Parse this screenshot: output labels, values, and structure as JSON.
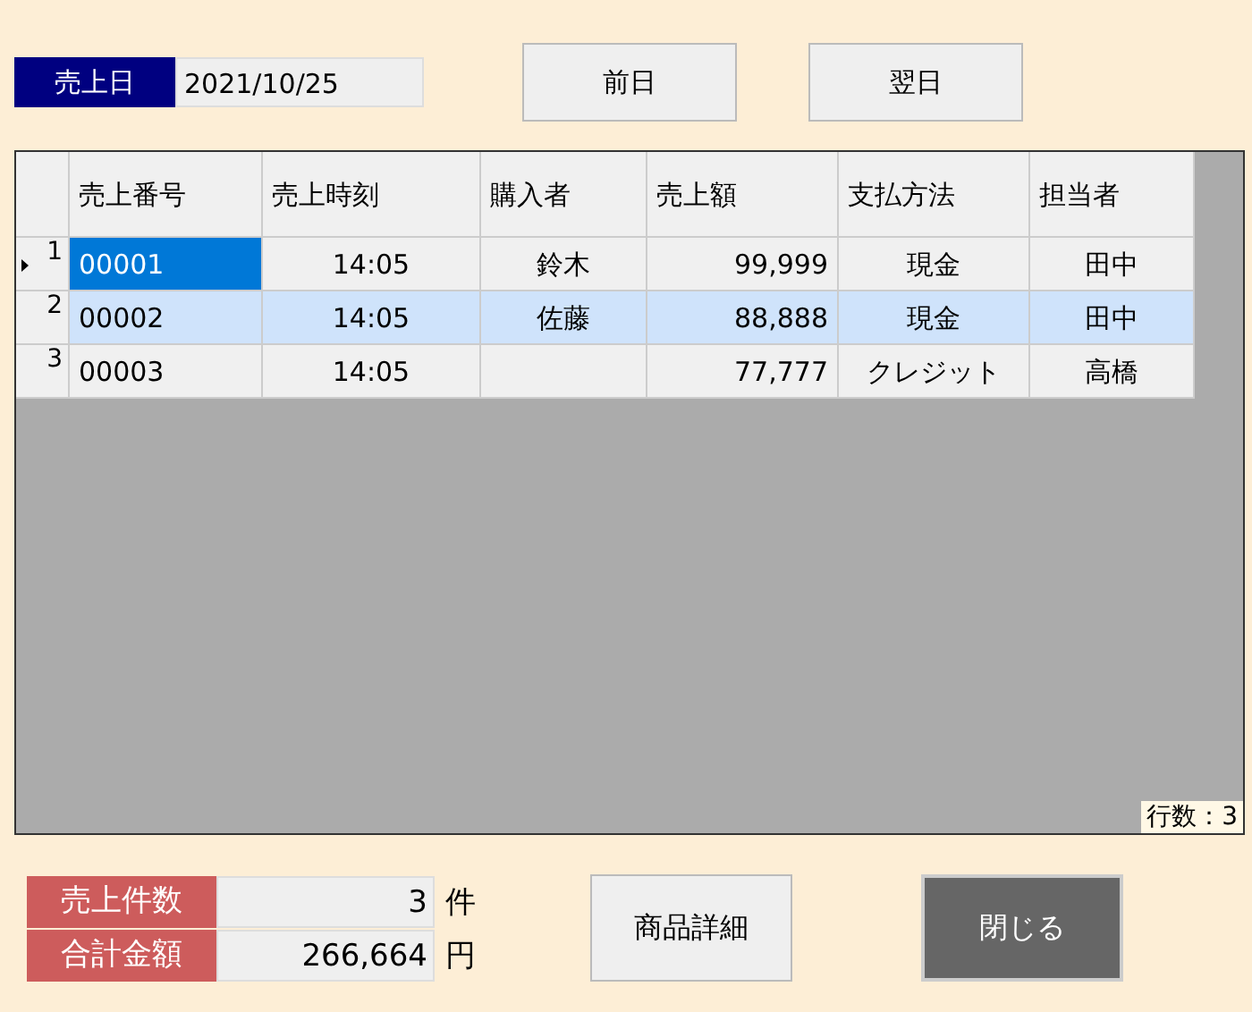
{
  "date_field": {
    "label": "売上日",
    "value": "2021/10/25"
  },
  "nav_buttons": [
    "前日",
    "翌日"
  ],
  "table": {
    "columns": [
      "売上番号",
      "売上時刻",
      "購入者",
      "売上額",
      "支払方法",
      "担当者"
    ],
    "rows": [
      {
        "number": "1",
        "current": true,
        "selected": false,
        "cells": [
          "00001",
          "14:05",
          "鈴木",
          "99,999",
          "現金",
          "田中"
        ]
      },
      {
        "number": "2",
        "current": false,
        "selected": true,
        "cells": [
          "00002",
          "14:05",
          "佐藤",
          "88,888",
          "現金",
          "田中"
        ]
      },
      {
        "number": "3",
        "current": false,
        "selected": false,
        "cells": [
          "00003",
          "14:05",
          "",
          "77,777",
          "クレジット",
          "高橋"
        ]
      }
    ],
    "row_count": "行数：3"
  },
  "summary": [
    {
      "label": "売上件数",
      "value": "3",
      "unit": "件"
    },
    {
      "label": "合計金額",
      "value": "266,664",
      "unit": "円"
    }
  ],
  "buttons": [
    {
      "label": "商品詳細",
      "kind": "normal"
    },
    {
      "label": "閉じる",
      "kind": "dark"
    }
  ]
}
